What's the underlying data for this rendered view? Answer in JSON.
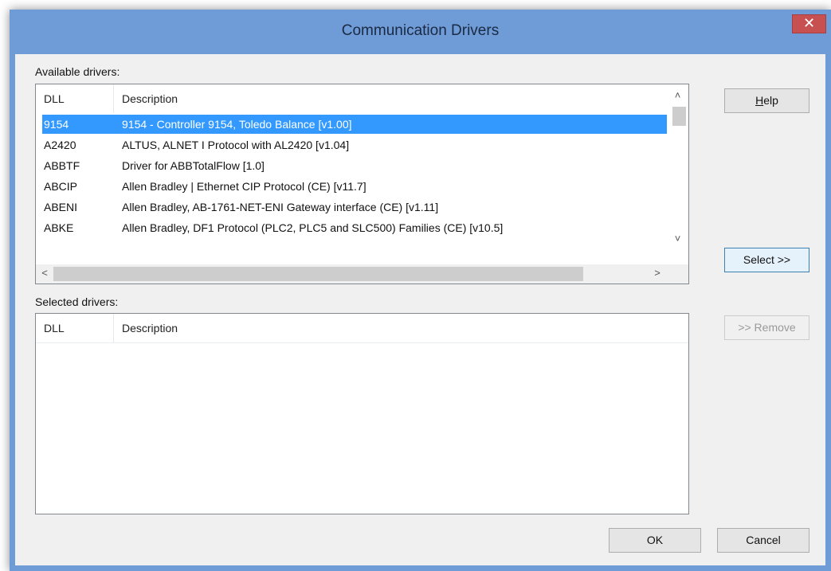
{
  "window": {
    "title": "Communication Drivers",
    "close_glyph": "✕"
  },
  "available": {
    "label": "Available drivers:",
    "columns": {
      "dll": "DLL",
      "description": "Description"
    },
    "rows": [
      {
        "dll": "9154",
        "description": "9154 - Controller 9154, Toledo Balance [v1.00]",
        "selected": true
      },
      {
        "dll": "A2420",
        "description": "ALTUS, ALNET I Protocol with AL2420 [v1.04]",
        "selected": false
      },
      {
        "dll": "ABBTF",
        "description": "Driver for ABBTotalFlow [1.0]",
        "selected": false
      },
      {
        "dll": "ABCIP",
        "description": "Allen Bradley | Ethernet CIP Protocol (CE) [v11.7]",
        "selected": false
      },
      {
        "dll": "ABENI",
        "description": "Allen Bradley, AB-1761-NET-ENI Gateway interface (CE) [v1.11]",
        "selected": false
      },
      {
        "dll": "ABKE",
        "description": "Allen Bradley, DF1 Protocol (PLC2, PLC5 and SLC500) Families (CE) [v10.5]",
        "selected": false
      }
    ],
    "scroll_up_glyph": "˄",
    "scroll_down_glyph": "˅",
    "scroll_left_glyph": "<",
    "scroll_right_glyph": ">"
  },
  "selected_drivers": {
    "label": "Selected drivers:",
    "columns": {
      "dll": "DLL",
      "description": "Description"
    }
  },
  "buttons": {
    "help_mnemonic": "H",
    "help_rest": "elp",
    "select": "Select >>",
    "remove": ">> Remove",
    "ok": "OK",
    "cancel": "Cancel"
  },
  "colors": {
    "frame": "#6f9bd6",
    "selection": "#3399ff",
    "close": "#c75050"
  }
}
